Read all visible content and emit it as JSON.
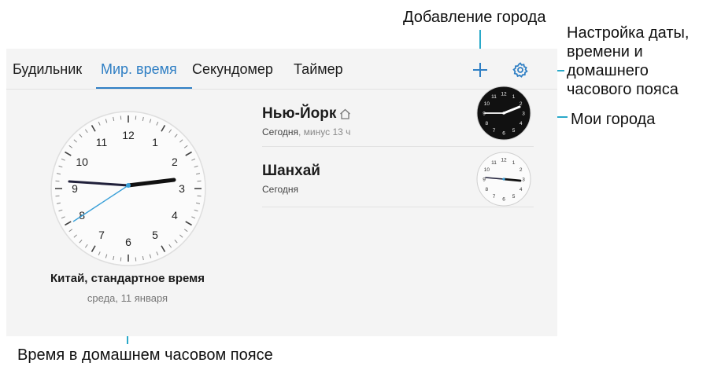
{
  "callouts": {
    "add_city": "Добавление города",
    "settings": "Настройка даты, времени и домашнего часового пояса",
    "my_cities": "Мои города",
    "home_time": "Время в домашнем часовом поясе"
  },
  "tabs": [
    {
      "label": "Будильник",
      "active": false
    },
    {
      "label": "Мир. время",
      "active": true
    },
    {
      "label": "Секундомер",
      "active": false
    },
    {
      "label": "Таймер",
      "active": false
    }
  ],
  "home_clock": {
    "zone": "Китай, стандартное время",
    "date": "среда, 11 января",
    "numerals": [
      "12",
      "1",
      "2",
      "3",
      "4",
      "5",
      "6",
      "7",
      "8",
      "9",
      "10",
      "11"
    ]
  },
  "cities": [
    {
      "name": "Нью-Йорк",
      "home_icon": "home-icon",
      "day": "Сегодня",
      "offset": ", минус 13 ч",
      "clock_style": "dark"
    },
    {
      "name": "Шанхай",
      "home_icon": "",
      "day": "Сегодня",
      "offset": "",
      "clock_style": "light"
    }
  ],
  "icons": {
    "add": "plus-icon",
    "settings": "gear-icon"
  },
  "colors": {
    "accent": "#2f7fc4",
    "leader": "#2aa9c9",
    "second_hand": "#3aa0d8"
  }
}
